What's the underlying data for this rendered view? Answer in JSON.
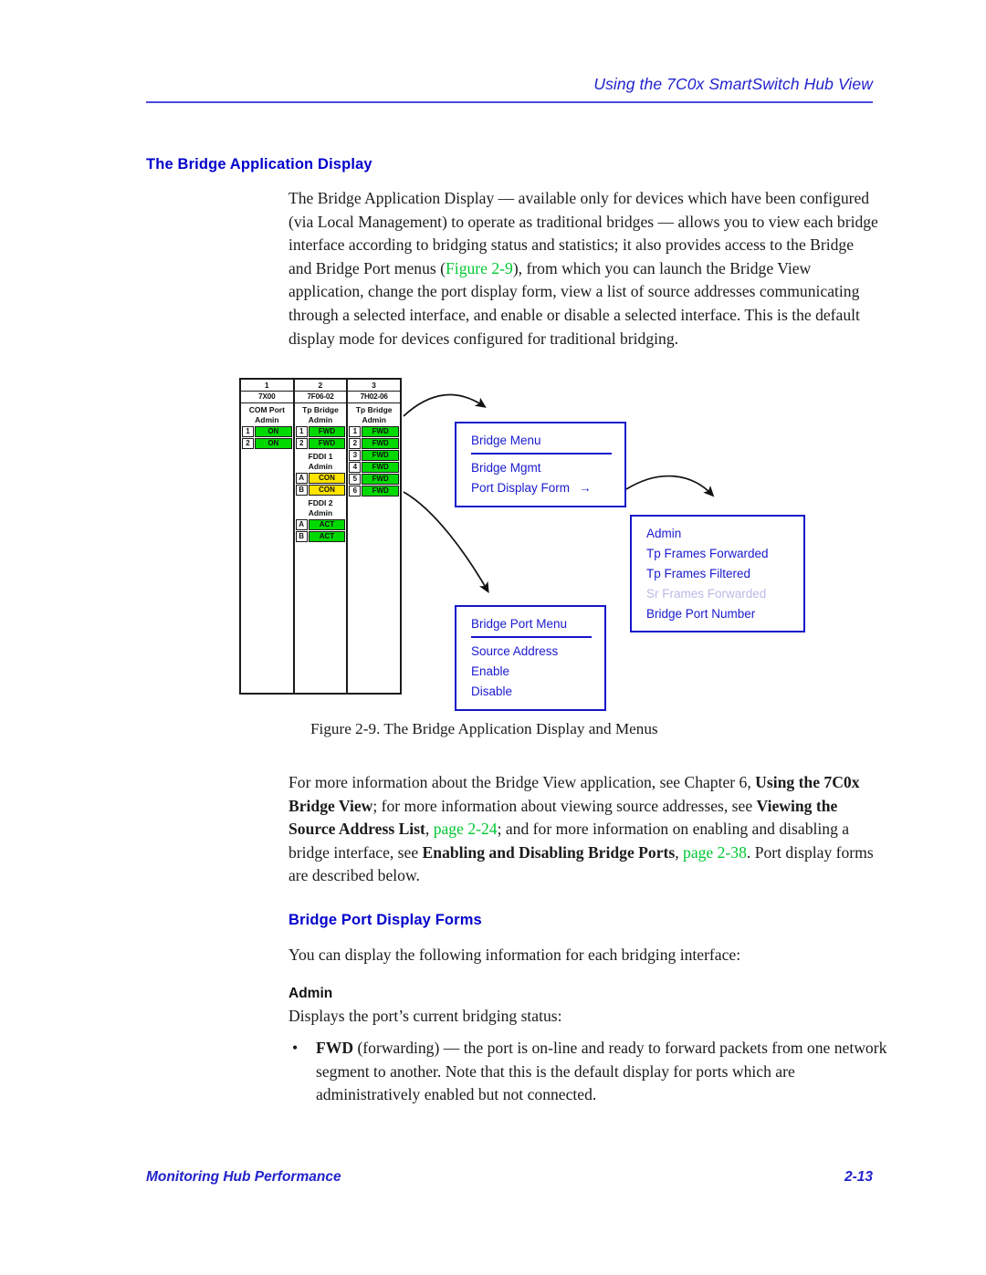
{
  "header": {
    "title": "Using the 7C0x SmartSwitch Hub View"
  },
  "headings": {
    "bridge_application_display": "The Bridge Application Display",
    "bridge_port_display_forms": "Bridge Port Display Forms",
    "admin": "Admin"
  },
  "paragraphs": {
    "intro": "The Bridge Application Display — available only for devices which have been configured (via Local Management) to operate as traditional bridges — allows you to view each bridge interface according to bridging status and statistics; it also provides access to the Bridge and Bridge Port menus (Figure 2-9), from which you can launch the Bridge View application, change the port display form, view a list of source addresses communicating through a selected interface, and enable or disable a selected interface. This is the default display mode for devices configured for traditional bridging.",
    "intro_link": "Figure 2-9",
    "more_info_1": "For more information about the Bridge View application, see Chapter 6, ",
    "more_info_b1": "Using the 7C0x Bridge View",
    "more_info_2": "; for more information about viewing source addresses, see ",
    "more_info_b2": "Viewing the Source Address List",
    "more_info_3": ", ",
    "more_info_link1": "page 2-24",
    "more_info_4": "; and for more information on enabling and disabling a bridge interface, see ",
    "more_info_b3": "Enabling and Disabling Bridge Ports",
    "more_info_5": ", ",
    "more_info_link2": "page 2-38",
    "more_info_6": ". Port display forms are described below.",
    "display_info": "You can display the following information for each bridging interface:",
    "admin_desc": "Displays the port’s current bridging status:",
    "bullet_dot": "•",
    "bullet_bold": "FWD",
    "bullet_text": " (forwarding) — the port is on-line and ready to forward packets from one network segment to another. Note that this is the default display for ports which are administratively enabled but not connected."
  },
  "figure": {
    "caption": "Figure 2-9.  The Bridge Application Display and Menus",
    "chassis": {
      "slots": [
        {
          "number": "1",
          "model": "7X00",
          "groups": [
            {
              "title_line1": "COM Port",
              "title_line2": "Admin",
              "ports": [
                {
                  "id": "1",
                  "status": "ON",
                  "color": "green"
                },
                {
                  "id": "2",
                  "status": "ON",
                  "color": "green"
                }
              ]
            }
          ]
        },
        {
          "number": "2",
          "model": "7F06-02",
          "groups": [
            {
              "title_line1": "Tp Bridge",
              "title_line2": "Admin",
              "ports": [
                {
                  "id": "1",
                  "status": "FWD",
                  "color": "green"
                },
                {
                  "id": "2",
                  "status": "FWD",
                  "color": "green"
                }
              ]
            },
            {
              "title_line1": "FDDI 1",
              "title_line2": "Admin",
              "ports": [
                {
                  "id": "A",
                  "status": "CON",
                  "color": "yellow"
                },
                {
                  "id": "B",
                  "status": "CON",
                  "color": "yellow"
                }
              ]
            },
            {
              "title_line1": "FDDI 2",
              "title_line2": "Admin",
              "ports": [
                {
                  "id": "A",
                  "status": "ACT",
                  "color": "green"
                },
                {
                  "id": "B",
                  "status": "ACT",
                  "color": "green"
                }
              ]
            }
          ]
        },
        {
          "number": "3",
          "model": "7H02-06",
          "groups": [
            {
              "title_line1": "Tp Bridge",
              "title_line2": "Admin",
              "ports": [
                {
                  "id": "1",
                  "status": "FWD",
                  "color": "green"
                },
                {
                  "id": "2",
                  "status": "FWD",
                  "color": "green"
                },
                {
                  "id": "3",
                  "status": "FWD",
                  "color": "green"
                },
                {
                  "id": "4",
                  "status": "FWD",
                  "color": "green"
                },
                {
                  "id": "5",
                  "status": "FWD",
                  "color": "green"
                },
                {
                  "id": "6",
                  "status": "FWD",
                  "color": "green"
                }
              ]
            }
          ]
        }
      ]
    },
    "menus": {
      "bridge_menu": {
        "title": "Bridge Menu",
        "items": [
          {
            "label": "Bridge Mgmt",
            "disabled": false,
            "submenu_arrow": false
          },
          {
            "label": "Port Display Form",
            "disabled": false,
            "submenu_arrow": true
          }
        ],
        "submenu_arrow_glyph": "→"
      },
      "port_display_form": {
        "items": [
          {
            "label": "Admin",
            "disabled": false
          },
          {
            "label": "Tp Frames Forwarded",
            "disabled": false
          },
          {
            "label": "Tp Frames Filtered",
            "disabled": false
          },
          {
            "label": "Sr Frames Forwarded",
            "disabled": true
          },
          {
            "label": "Bridge Port Number",
            "disabled": false
          }
        ]
      },
      "bridge_port_menu": {
        "title": "Bridge Port Menu",
        "items": [
          {
            "label": "Source Address",
            "disabled": false
          },
          {
            "label": "Enable",
            "disabled": false
          },
          {
            "label": "Disable",
            "disabled": false
          }
        ]
      }
    }
  },
  "footer": {
    "section": "Monitoring Hub Performance",
    "page_number": "2-13"
  },
  "colors": {
    "heading_blue": "#0000cc",
    "header_blue": "#2222cc",
    "link_green": "#00c832",
    "menu_border": "#1515cc",
    "status_green": "#00d900",
    "status_yellow": "#ffe400",
    "disabled_text": "#b9b9e8"
  }
}
